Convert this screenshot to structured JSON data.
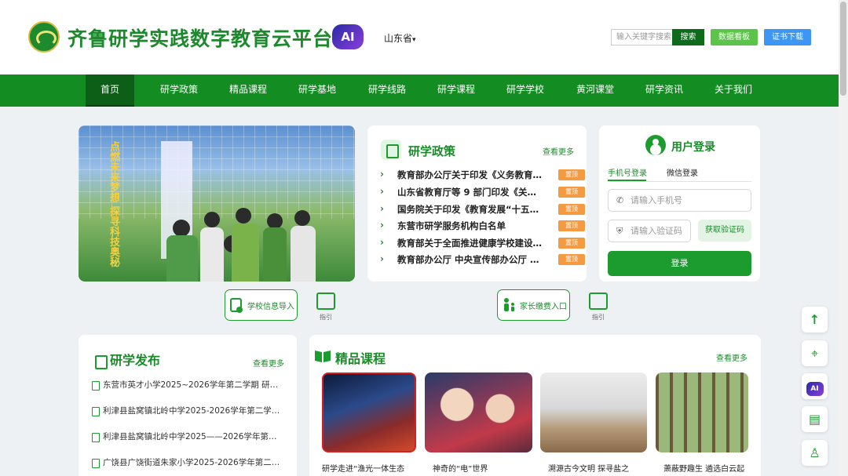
{
  "header": {
    "site_title": "齐鲁研学实践数字教育云平台",
    "ai_label": "AI",
    "province": "山东省",
    "search_placeholder": "输入关键字搜索",
    "search_button": "搜索",
    "data_button": "数据看板",
    "cert_button": "证书下载"
  },
  "nav": {
    "items": [
      {
        "label": "首页"
      },
      {
        "label": "研学政策"
      },
      {
        "label": "精品课程"
      },
      {
        "label": "研学基地"
      },
      {
        "label": "研学线路"
      },
      {
        "label": "研学课程"
      },
      {
        "label": "研学学校"
      },
      {
        "label": "黄河课堂"
      },
      {
        "label": "研学资讯"
      },
      {
        "label": "关于我们"
      }
    ]
  },
  "banner": {
    "slogan": "点燃未来梦想 探寻科技奥秘"
  },
  "policy": {
    "title": "研学政策",
    "more": "查看更多",
    "tag": "置顶",
    "items": [
      {
        "text": "教育部办公厅关于印发《义务教育阶…"
      },
      {
        "text": "山东省教育厅等 9 部门印发《关于进…"
      },
      {
        "text": "国务院关于印发《教育发展“十五五…"
      },
      {
        "text": "东营市研学服务机构白名单"
      },
      {
        "text": "教育部关于全面推进健康学校建设的…"
      },
      {
        "text": "教育部办公厅 中央宣传部办公厅 关…"
      }
    ]
  },
  "login": {
    "title": "用户登录",
    "tab_phone": "手机号登录",
    "tab_wechat": "微信登录",
    "phone_placeholder": "请输入手机号",
    "code_placeholder": "请输入验证码",
    "get_code": "获取验证码",
    "submit": "登录"
  },
  "quick": {
    "school_import": "学校信息导入",
    "parent_pay": "家长缴费入口",
    "guide": "指引"
  },
  "publish": {
    "title": "研学发布",
    "more": "查看更多",
    "items": [
      {
        "text": "东营市英才小学2025~2026学年第二学期 研…"
      },
      {
        "text": "利津县盐窝镇北岭中学2025-2026学年第二学…"
      },
      {
        "text": "利津县盐窝镇北岭中学2025——2026学年第…"
      },
      {
        "text": "广饶县广饶街道朱家小学2025-2026学年第二…"
      }
    ]
  },
  "courses": {
    "title": "精品课程",
    "more": "查看更多",
    "items": [
      {
        "caption": "研学走进“渔光一体生态"
      },
      {
        "caption": "神奇的“电”世界"
      },
      {
        "caption": "溯源古今文明 探寻盐之"
      },
      {
        "caption": "萧蔽野趣生 遴选白云起"
      }
    ]
  },
  "float": {
    "ai_label": "AI"
  }
}
